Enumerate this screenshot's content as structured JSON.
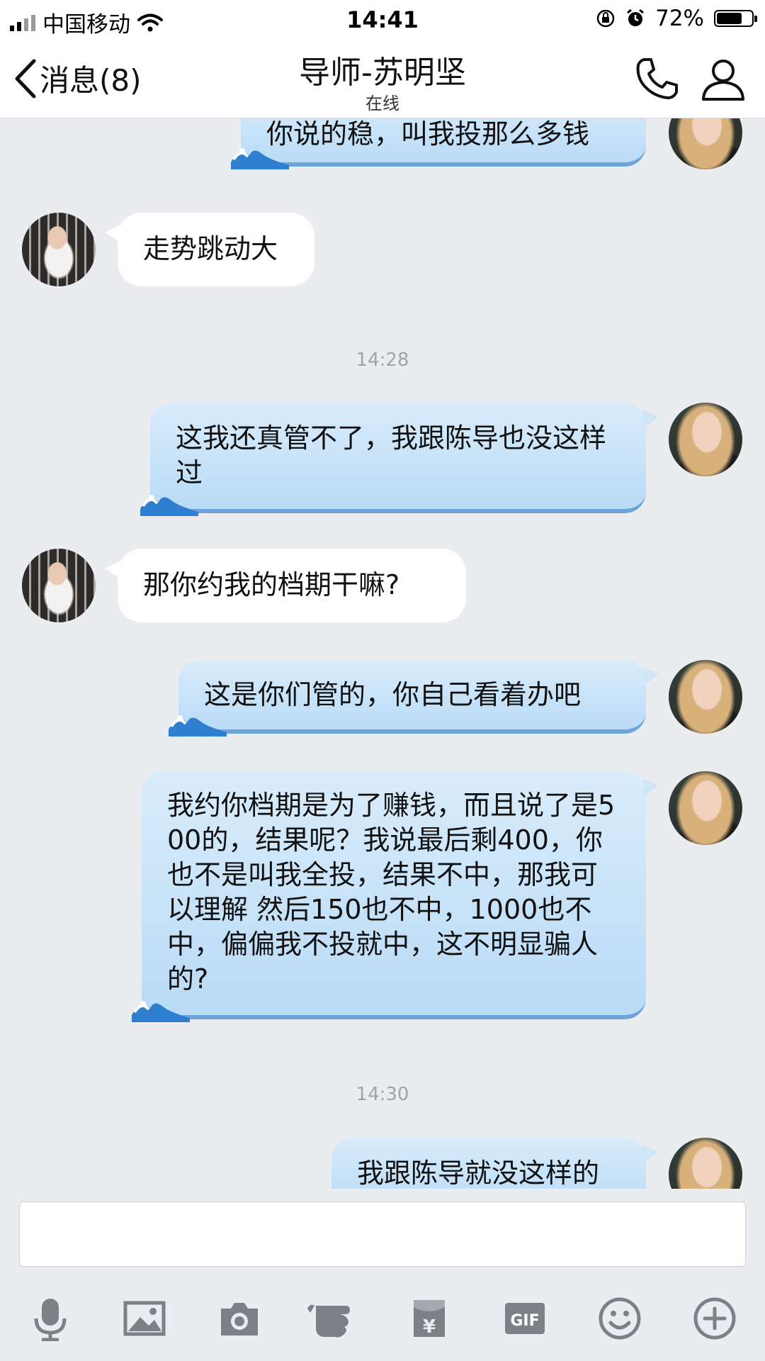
{
  "status_bar": {
    "carrier": "中国移动",
    "time": "14:41",
    "battery": "72%",
    "battery_level": 0.72
  },
  "header": {
    "back_label": "消息(8)",
    "title": "导师-苏明坚",
    "subtitle": "在线"
  },
  "messages": [
    {
      "side": "out",
      "text": "你说的稳，叫我投那么多钱"
    },
    {
      "side": "in",
      "text": "走势跳动大"
    },
    {
      "timestamp": "14:28"
    },
    {
      "side": "out",
      "text": "这我还真管不了，我跟陈导也没这样过"
    },
    {
      "side": "in",
      "text": "那你约我的档期干嘛?"
    },
    {
      "side": "out",
      "text": "这是你们管的，你自己看着办吧"
    },
    {
      "side": "out",
      "text": "我约你档期是为了赚钱，而且说了是500的，结果呢？我说最后剩400，你也不是叫我全投，结果不中，那我可以理解 然后150也不中，1000也不中，偏偏我不投就中，这不明显骗人的?"
    },
    {
      "timestamp": "14:30"
    },
    {
      "side": "out",
      "text": "我跟陈导就没这样的"
    }
  ],
  "input": {
    "value": ""
  },
  "toolbar": {
    "icons": [
      "microphone-icon",
      "image-icon",
      "camera-icon",
      "poke-icon",
      "red-packet-icon",
      "gif-icon",
      "emoji-icon",
      "plus-icon"
    ],
    "gif_label": "GIF",
    "yen_label": "¥"
  },
  "colors": {
    "background": "#ebecf0",
    "bubble_out": "#c6e2f8",
    "bubble_in": "#ffffff",
    "timestamp": "#a2a3a8"
  }
}
